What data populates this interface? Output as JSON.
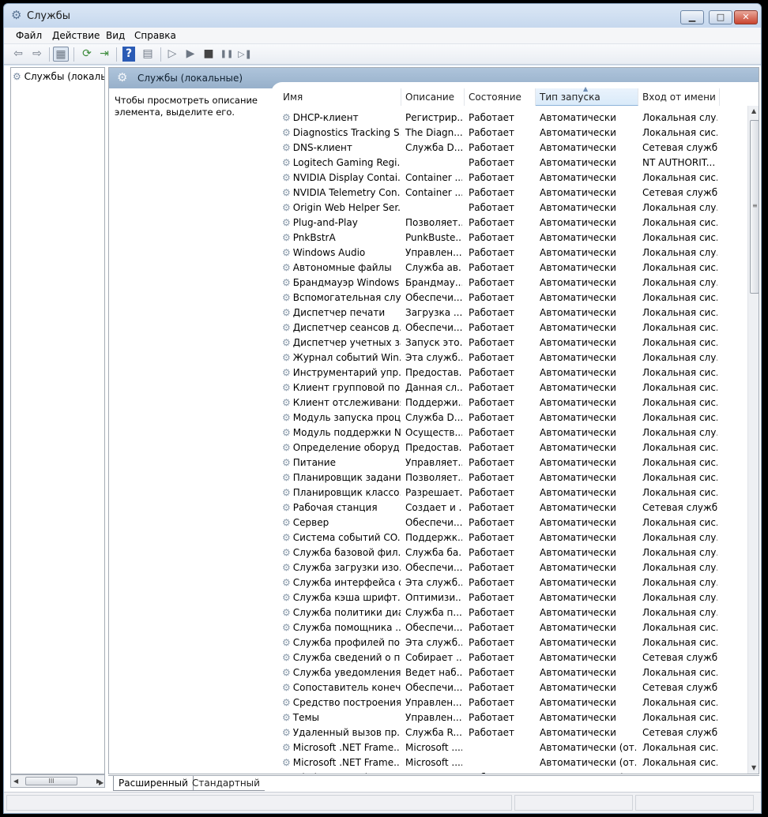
{
  "window": {
    "title": "Службы",
    "icons": {
      "app": "gear-icon",
      "minimize": "minimize-icon",
      "maximize": "maximize-icon",
      "close": "close-icon"
    },
    "buttons": {
      "minimize": "▁",
      "maximize": "□",
      "close": "✕"
    }
  },
  "menu": [
    "Файл",
    "Действие",
    "Вид",
    "Справка"
  ],
  "toolbar": {
    "glyphs": {
      "back": "⇦",
      "forward": "⇨",
      "show_tree": "▦",
      "refresh": "⟳",
      "export": "⇥",
      "help": "?",
      "properties": "▤",
      "start": "▷",
      "start2": "▶",
      "stop": "■",
      "pause": "❚❚",
      "resume": "▷❚"
    }
  },
  "tree": {
    "item_label": "Службы (локалы",
    "scroll_thumb": "III"
  },
  "pane": {
    "title": "Службы (локальные)",
    "description": "Чтобы просмотреть описание элемента, выделите его."
  },
  "columns": {
    "name": "Имя",
    "description": "Описание",
    "state": "Состояние",
    "startup": "Тип запуска",
    "logon": "Вход от имени"
  },
  "sort": {
    "column": "startup",
    "direction": "ascending"
  },
  "services": [
    [
      "DHCP-клиент",
      "Регистрир...",
      "Работает",
      "Автоматически",
      "Локальная слу..."
    ],
    [
      "Diagnostics Tracking S...",
      "The Diagn...",
      "Работает",
      "Автоматически",
      "Локальная сис..."
    ],
    [
      "DNS-клиент",
      "Служба D...",
      "Работает",
      "Автоматически",
      "Сетевая служба"
    ],
    [
      "Logitech Gaming Regi...",
      "",
      "Работает",
      "Автоматически",
      "NT AUTHORIT..."
    ],
    [
      "NVIDIA Display Contai...",
      "Container ...",
      "Работает",
      "Автоматически",
      "Локальная сис..."
    ],
    [
      "NVIDIA Telemetry Con...",
      "Container ...",
      "Работает",
      "Автоматически",
      "Сетевая служба"
    ],
    [
      "Origin Web Helper Ser...",
      "",
      "Работает",
      "Автоматически",
      "Локальная слу..."
    ],
    [
      "Plug-and-Play",
      "Позволяет...",
      "Работает",
      "Автоматически",
      "Локальная сис..."
    ],
    [
      "PnkBstrA",
      "PunkBuste...",
      "Работает",
      "Автоматически",
      "Локальная сис..."
    ],
    [
      "Windows Audio",
      "Управлен...",
      "Работает",
      "Автоматически",
      "Локальная слу..."
    ],
    [
      "Автономные файлы",
      "Служба ав...",
      "Работает",
      "Автоматически",
      "Локальная сис..."
    ],
    [
      "Брандмауэр Windows",
      "Брандмау...",
      "Работает",
      "Автоматически",
      "Локальная слу..."
    ],
    [
      "Вспомогательная слу...",
      "Обеспечи...",
      "Работает",
      "Автоматически",
      "Локальная сис..."
    ],
    [
      "Диспетчер печати",
      "Загрузка ...",
      "Работает",
      "Автоматически",
      "Локальная сис..."
    ],
    [
      "Диспетчер сеансов д...",
      "Обеспечи...",
      "Работает",
      "Автоматически",
      "Локальная сис..."
    ],
    [
      "Диспетчер учетных за...",
      "Запуск это...",
      "Работает",
      "Автоматически",
      "Локальная сис..."
    ],
    [
      "Журнал событий Win...",
      "Эта служб...",
      "Работает",
      "Автоматически",
      "Локальная слу..."
    ],
    [
      "Инструментарий упр...",
      "Предостав...",
      "Работает",
      "Автоматически",
      "Локальная сис..."
    ],
    [
      "Клиент групповой по...",
      "Данная сл...",
      "Работает",
      "Автоматически",
      "Локальная сис..."
    ],
    [
      "Клиент отслеживания...",
      "Поддержи...",
      "Работает",
      "Автоматически",
      "Локальная сис..."
    ],
    [
      "Модуль запуска проц...",
      "Служба D...",
      "Работает",
      "Автоматически",
      "Локальная сис..."
    ],
    [
      "Модуль поддержки N...",
      "Осуществ...",
      "Работает",
      "Автоматически",
      "Локальная слу..."
    ],
    [
      "Определение оборуд...",
      "Предостав...",
      "Работает",
      "Автоматически",
      "Локальная сис..."
    ],
    [
      "Питание",
      "Управляет...",
      "Работает",
      "Автоматически",
      "Локальная сис..."
    ],
    [
      "Планировщик заданий",
      "Позволяет...",
      "Работает",
      "Автоматически",
      "Локальная сис..."
    ],
    [
      "Планировщик классо...",
      "Разрешает...",
      "Работает",
      "Автоматически",
      "Локальная сис..."
    ],
    [
      "Рабочая станция",
      "Создает и ...",
      "Работает",
      "Автоматически",
      "Сетевая служба"
    ],
    [
      "Сервер",
      "Обеспечи...",
      "Работает",
      "Автоматически",
      "Локальная сис..."
    ],
    [
      "Система событий CO...",
      "Поддержк...",
      "Работает",
      "Автоматически",
      "Локальная слу..."
    ],
    [
      "Служба базовой фил...",
      "Служба ба...",
      "Работает",
      "Автоматически",
      "Локальная слу..."
    ],
    [
      "Служба загрузки изо...",
      "Обеспечи...",
      "Работает",
      "Автоматически",
      "Локальная слу..."
    ],
    [
      "Служба интерфейса с...",
      "Эта служб...",
      "Работает",
      "Автоматически",
      "Локальная слу..."
    ],
    [
      "Служба кэша шрифт...",
      "Оптимизи...",
      "Работает",
      "Автоматически",
      "Локальная слу..."
    ],
    [
      "Служба политики диа...",
      "Служба п...",
      "Работает",
      "Автоматически",
      "Локальная слу..."
    ],
    [
      "Служба помощника ...",
      "Обеспечи...",
      "Работает",
      "Автоматически",
      "Локальная сис..."
    ],
    [
      "Служба профилей по...",
      "Эта служб...",
      "Работает",
      "Автоматически",
      "Локальная сис..."
    ],
    [
      "Служба сведений о п...",
      "Собирает ...",
      "Работает",
      "Автоматически",
      "Сетевая служба"
    ],
    [
      "Служба уведомления...",
      "Ведет наб...",
      "Работает",
      "Автоматически",
      "Локальная сис..."
    ],
    [
      "Сопоставитель конеч...",
      "Обеспечи...",
      "Работает",
      "Автоматически",
      "Сетевая служба"
    ],
    [
      "Средство построения...",
      "Управлен...",
      "Работает",
      "Автоматически",
      "Локальная сис..."
    ],
    [
      "Темы",
      "Управлен...",
      "Работает",
      "Автоматически",
      "Локальная сис..."
    ],
    [
      "Удаленный вызов пр...",
      "Служба R...",
      "Работает",
      "Автоматически",
      "Сетевая служба"
    ],
    [
      "Microsoft .NET Frame...",
      "Microsoft ....",
      "",
      "Автоматически (от...",
      "Локальная сис..."
    ],
    [
      "Microsoft .NET Frame...",
      "Microsoft ....",
      "",
      "Автоматически (от...",
      "Локальная сис..."
    ],
    [
      "Windows Search",
      "Индексир...",
      "Работает",
      "Автоматически (от...",
      "Локальная сис..."
    ]
  ],
  "tabs": [
    "Расширенный",
    "Стандартный"
  ]
}
